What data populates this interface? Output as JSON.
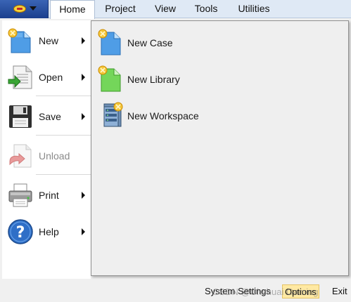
{
  "menubar": {
    "tabs": [
      {
        "label": "Home"
      },
      {
        "label": "Project"
      },
      {
        "label": "View"
      },
      {
        "label": "Tools"
      },
      {
        "label": "Utilities"
      }
    ]
  },
  "leftmenu": {
    "items": [
      {
        "label": "New",
        "icon": "new-document-icon"
      },
      {
        "label": "Open",
        "icon": "open-document-icon"
      },
      {
        "label": "Save",
        "icon": "floppy-disk-icon"
      },
      {
        "label": "Unload",
        "icon": "unload-icon"
      },
      {
        "label": "Print",
        "icon": "printer-icon"
      },
      {
        "label": "Help",
        "icon": "help-icon"
      }
    ]
  },
  "submenu": {
    "items": [
      {
        "label": "New Case",
        "icon": "new-case-icon"
      },
      {
        "label": "New Library",
        "icon": "new-library-icon"
      },
      {
        "label": "New Workspace",
        "icon": "new-workspace-icon"
      }
    ]
  },
  "statusbar": {
    "system_settings": "System Settings",
    "options": "Options",
    "exit": "Exit"
  },
  "watermark": "CSDN @Chshuai Gaming"
}
